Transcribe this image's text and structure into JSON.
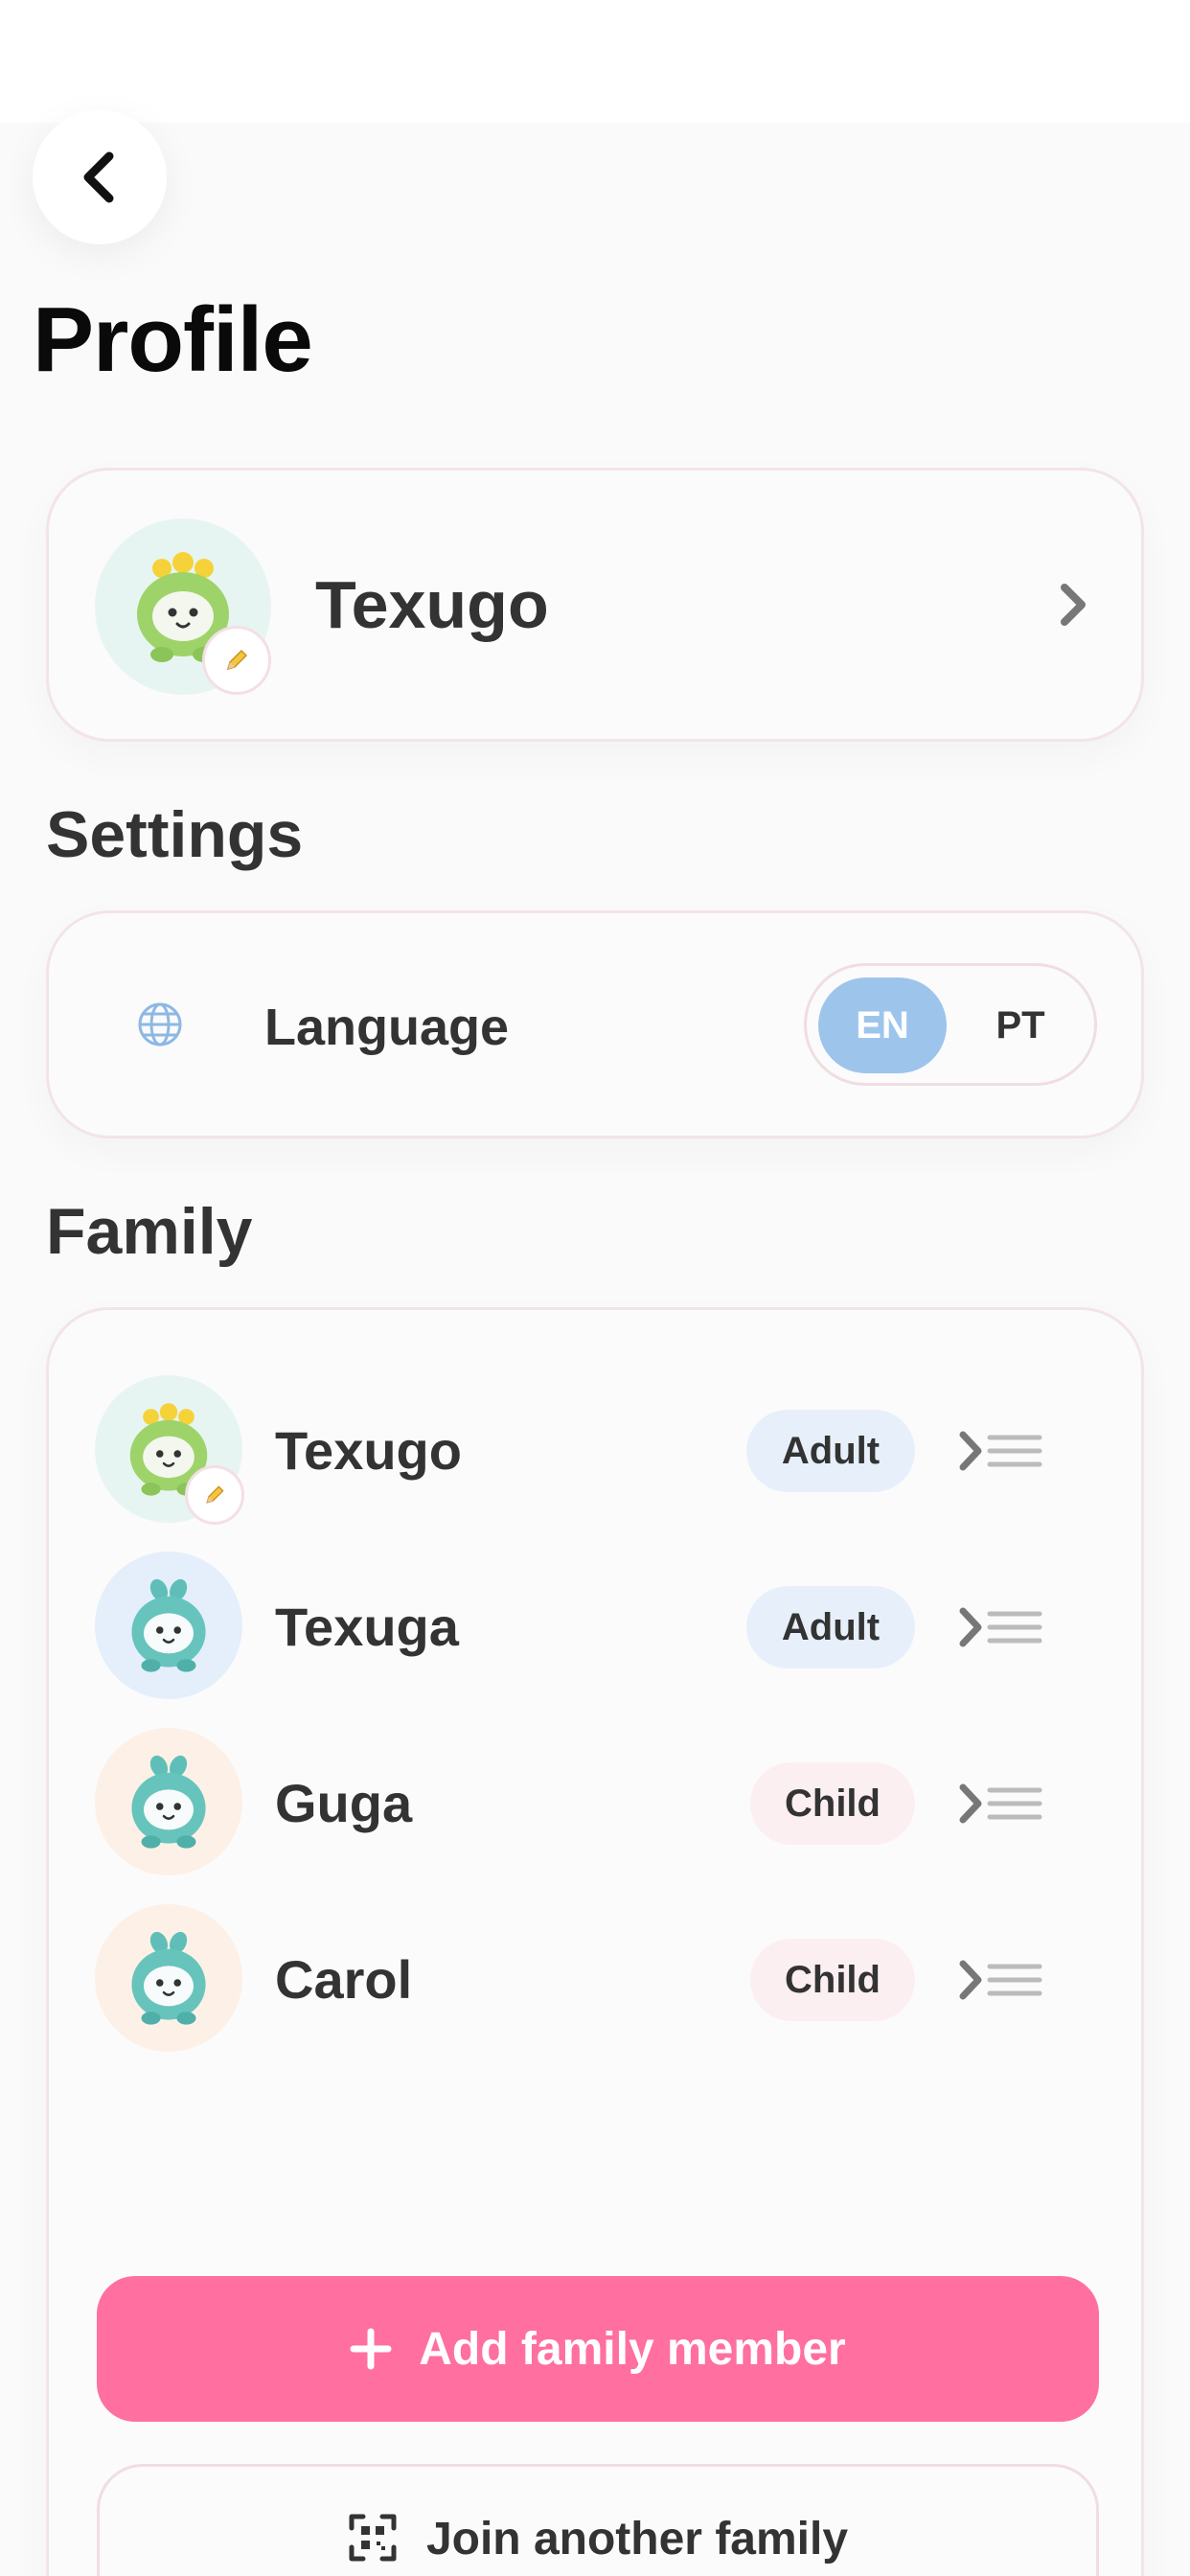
{
  "header": {
    "title": "Profile",
    "back_icon": "chevron-left-icon"
  },
  "profile": {
    "name": "Texugo",
    "avatar_icon": "green-monster-avatar-icon",
    "edit_icon": "pencil-icon"
  },
  "settings": {
    "title": "Settings",
    "language_label": "Language",
    "language_icon": "globe-icon",
    "language_options": [
      "EN",
      "PT"
    ],
    "language_selected": "EN"
  },
  "family": {
    "title": "Family",
    "members": [
      {
        "name": "Texugo",
        "role": "Adult",
        "avatar": "green-monster",
        "editable": true
      },
      {
        "name": "Texuga",
        "role": "Adult",
        "avatar": "teal-sprout"
      },
      {
        "name": "Guga",
        "role": "Child",
        "avatar": "teal-sprout"
      },
      {
        "name": "Carol",
        "role": "Child",
        "avatar": "teal-sprout"
      }
    ],
    "add_label": "Add family member",
    "join_label": "Join another family"
  },
  "colors": {
    "accent_pink": "#ff6f9f",
    "toggle_active": "#9dc5ec",
    "adult_badge": "#e7f0fa",
    "child_badge": "#fbeff2"
  }
}
